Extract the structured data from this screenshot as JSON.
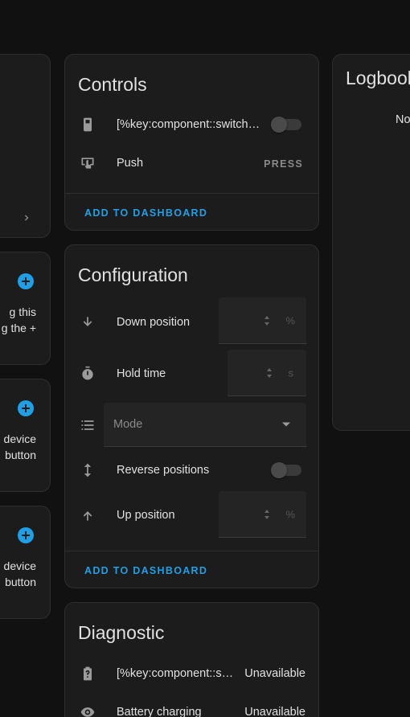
{
  "left_column": {
    "cards": [
      {
        "line1": "g this",
        "line2": "g the +"
      },
      {
        "line1": "s device",
        "line2": "button"
      },
      {
        "line1": "device",
        "line2": "button"
      }
    ]
  },
  "controls": {
    "title": "Controls",
    "rows": [
      {
        "icon": "remote-icon",
        "label": "[%key:component::switch::title%]",
        "state": "off"
      },
      {
        "icon": "gesture-tap-icon",
        "label": "Push",
        "action": "PRESS"
      }
    ],
    "footer": "ADD TO DASHBOARD"
  },
  "configuration": {
    "title": "Configuration",
    "rows": [
      {
        "icon": "arrow-down-icon",
        "label": "Down position",
        "unit": "%"
      },
      {
        "icon": "timer-icon",
        "label": "Hold time",
        "unit": "s"
      },
      {
        "icon": "list-icon",
        "placeholder": "Mode"
      },
      {
        "icon": "arrow-up-down-icon",
        "label": "Reverse positions",
        "state": "off"
      },
      {
        "icon": "arrow-up-icon",
        "label": "Up position",
        "unit": "%"
      }
    ],
    "footer": "ADD TO DASHBOARD"
  },
  "diagnostic": {
    "title": "Diagnostic",
    "rows": [
      {
        "icon": "battery-unknown-icon",
        "label": "[%key:component::sensor::entity_component::battery::name%]",
        "value": "Unavailable"
      },
      {
        "icon": "eye-icon",
        "label": "Battery charging",
        "value": "Unavailable"
      }
    ]
  },
  "logbook": {
    "title": "Logbook",
    "empty_text": "No"
  },
  "colors": {
    "background": "#111111",
    "card": "#1c1c1c",
    "accent": "#1fa0e6"
  }
}
